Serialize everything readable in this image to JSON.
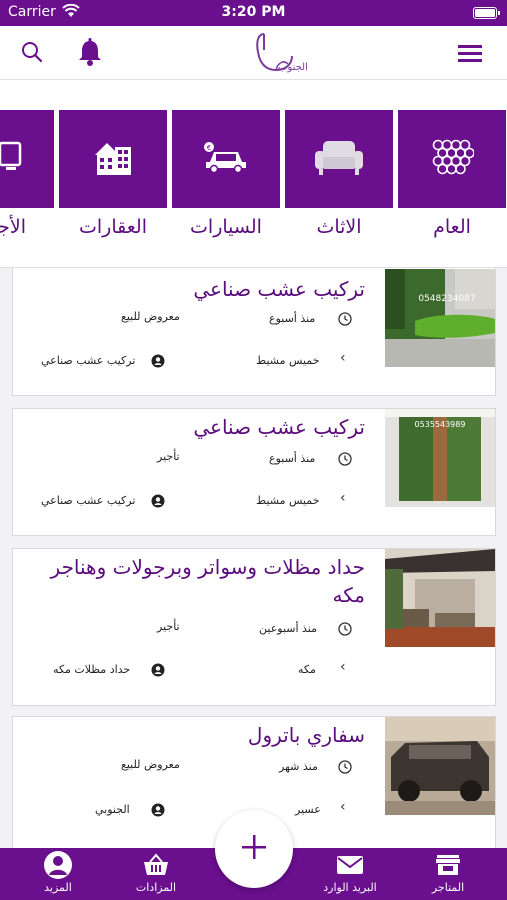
{
  "status_bar": {
    "carrier": "Carrier",
    "time": "3:20 PM"
  },
  "header": {
    "logo_text": "الجنوب"
  },
  "categories": [
    {
      "label": "العام",
      "icon": "honeycomb-icon"
    },
    {
      "label": "الاثاث",
      "icon": "sofa-icon"
    },
    {
      "label": "السيارات",
      "icon": "car-icon"
    },
    {
      "label": "العقارات",
      "icon": "buildings-icon"
    },
    {
      "label": "الأجه",
      "icon": "monitor-icon"
    }
  ],
  "listings": [
    {
      "title": "تركيب عشب صناعي",
      "time": "منذ أسبوع",
      "type": "معروض للبيع",
      "city": "خميس مشيط",
      "user": "تركيب عشب صناعي",
      "phone_overlay": "0548234087"
    },
    {
      "title": "تركيب عشب صناعي",
      "time": "منذ أسبوع",
      "type": "تأجير",
      "city": "خميس مشيط",
      "user": "تركيب عشب صناعي",
      "phone_overlay": "0535543989"
    },
    {
      "title": "حداد مظلات وسواتر وبرجولات وهناجر مكه",
      "time": "منذ أسبوعين",
      "type": "تأجير",
      "city": "مكه",
      "user": "حداد مظلات مكه"
    },
    {
      "title": "سفاري باترول",
      "time": "منذ شهر",
      "type": "معروض للبيع",
      "city": "عسير",
      "user": "الجنوبي"
    }
  ],
  "tabbar": [
    {
      "label": "المتاجر",
      "icon": "store-icon"
    },
    {
      "label": "البريد الوارد",
      "icon": "mail-icon"
    },
    {
      "label": "المزادات",
      "icon": "basket-icon"
    },
    {
      "label": "المزيد",
      "icon": "profile-icon"
    }
  ],
  "colors": {
    "primary": "#6a0f8e",
    "title": "#5a0d7c"
  }
}
